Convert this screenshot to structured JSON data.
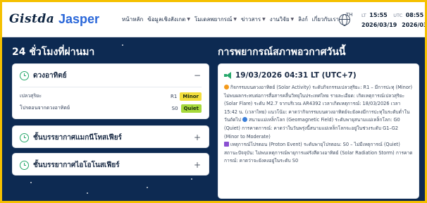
{
  "logos": {
    "gistda": "Gistda",
    "jasper": "Jasper"
  },
  "nav": {
    "items": [
      {
        "label": "หน้าหลัก",
        "dropdown": false
      },
      {
        "label": "ข้อมูลเชิงสังเกต",
        "dropdown": true
      },
      {
        "label": "โมเดลพยากรณ์",
        "dropdown": true
      },
      {
        "label": "ข่าวสาร",
        "dropdown": true
      },
      {
        "label": "งานวิจัย",
        "dropdown": true
      },
      {
        "label": "ลิงก์",
        "dropdown": false
      },
      {
        "label": "เกี่ยวกับเรา",
        "dropdown": false
      }
    ],
    "language": "TH",
    "lt_label": "LT",
    "lt_time": "15:55",
    "lt_date": "2026/03/19",
    "utc_label": "UTC",
    "utc_time": "08:55",
    "utc_date": "2026/03/19"
  },
  "left": {
    "title": "24 ชั่วโมงที่ผ่านมา",
    "cards": [
      {
        "title": "ดวงอาทิตย์",
        "toggle": "−",
        "rows": [
          {
            "label": "เปลวสุริยะ",
            "code": "R1",
            "level": "Minor",
            "color": "#f2dd3b"
          },
          {
            "label": "โปรตอนจากดวงอาทิตย์",
            "code": "S0",
            "level": "Quiet",
            "color": "#a6d93a"
          }
        ]
      },
      {
        "title": "ชั้นบรรยากาศแมกนีโทสเฟียร์",
        "toggle": "+"
      },
      {
        "title": "ชั้นบรรยากาศไอโอโนสเฟียร์",
        "toggle": "+"
      }
    ]
  },
  "right": {
    "title": "การพยากรณ์สภาพอวกาศวันนี้",
    "date": "19/03/2026 04:31 LT (UTC+7)",
    "p1": "กิจกรรมบนดวงอาทิตย์ (Solar Activity) ระดับกิจกรรมเปลวสุริยะ: R1 – มีการปะทุ (Minor) ไม่พบผลกระทบต่อการสื่อสารคลื่นวิทยุในประเทศไทย รายละเอียด: เกิดเหตุการณ์เปลวสุริยะ (Solar Flare) ระดับ M2.7 จากบริเวณ AR4392 เวลาเกิดเหตุการณ์: 18/03/2026 เวลา 15:42 น. (เวลาไทย) แนวโน้ม: คาดว่ากิจกรรมบนดวงอาทิตย์จะยังคงมีการปะทุในระดับต่ำในวันถัดไป",
    "p2": "สนามแม่เหล็กโลก (Geomagnetic Field) ระดับพายุสนามแม่เหล็กโลก: G0 (Quiet) การคาดการณ์: คาดว่าในวันพรุ่งนี้สนามแม่เหล็กโลกจะอยู่ในช่วงระดับ G1–G2 (Minor to Moderate)",
    "p3": "เหตุการณ์โปรตอน (Proton Event) ระดับพายุโปรตอน: S0 – ไม่มีเหตุการณ์ (Quiet) สถานะปัจจุบัน: ไม่พบเหตุการณ์พายุการแผ่รังสีดวงอาทิตย์ (Solar Radiation Storm) การคาดการณ์: คาดว่าจะยังคงอยู่ในระดับ S0"
  },
  "colors": {
    "accent": "#27a86b",
    "background": "#0d2a52",
    "frame": "#f5c000"
  }
}
